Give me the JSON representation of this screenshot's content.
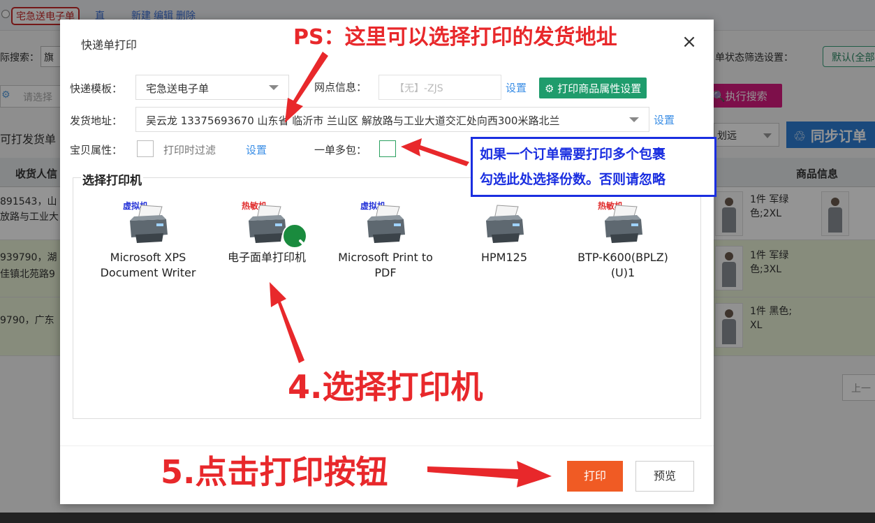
{
  "background": {
    "template_tag": "宅急送电子单",
    "template_tag_more": "直",
    "template_actions": [
      "新建",
      "编辑",
      "删除"
    ],
    "search_label": "际搜索：",
    "search_value": "旗",
    "status_filter_label": "单状态筛选设置：",
    "status_filter_button": "默认(全部",
    "condition_placeholder": "请选择",
    "execute_search_button": "执行搜索",
    "sub_tab": "可打发货单",
    "select_far_value": "划远",
    "sync_button": "同步订单",
    "columns": {
      "receiver": "收货人信",
      "goods": "商品信息"
    },
    "rows": [
      {
        "addr_line1": "891543，山",
        "addr_line2": "放路与工业大",
        "goods1": "1件 军绿\n色;2XL"
      },
      {
        "addr_line1": "939790，湖",
        "addr_line2": "佳镇北苑路9",
        "goods1": "1件 军绿\n色;3XL"
      },
      {
        "addr_line1": "9790，广东",
        "addr_line2": "",
        "goods1": "1件 黑色;\nXL"
      }
    ],
    "pager_prev": "上一"
  },
  "dialog": {
    "title": "快递单打印",
    "close_glyph": "×",
    "template_label": "快递模板：",
    "template_value": "宅急送电子单",
    "outlet_label": "网点信息：",
    "outlet_value": "【无】-ZJS",
    "outlet_settings": "设置",
    "goods_attr_settings_button": "打印商品属性设置",
    "sender_label": "发货地址：",
    "sender_value": "吴云龙 13375693670 山东省 临沂市 兰山区 解放路与工业大道交汇处向西300米路北兰",
    "sender_settings": "设置",
    "item_attr_label": "宝贝属性：",
    "print_filter_label": "打印时过滤",
    "item_attr_settings": "设置",
    "multi_pack_label": "一单多包：",
    "printer_section_title": "选择打印机",
    "printers": [
      {
        "tag": "虚拟机",
        "tag_type": "virtual",
        "name": "Microsoft XPS Document Writer",
        "selected": false
      },
      {
        "tag": "热敏机",
        "tag_type": "thermal",
        "name": "电子面单打印机",
        "selected": true
      },
      {
        "tag": "虚拟机",
        "tag_type": "virtual",
        "name": "Microsoft Print to PDF",
        "selected": false
      },
      {
        "tag": "",
        "tag_type": "none",
        "name": "HPM125",
        "selected": false
      },
      {
        "tag": "热敏机",
        "tag_type": "thermal",
        "name": "BTP-K600(BPLZ) (U)1",
        "selected": false
      }
    ],
    "print_button": "打印",
    "preview_button": "预览"
  },
  "annotations": {
    "ps": "PS：这里可以选择打印的发货地址",
    "note_line1": "如果一个订单需要打印多个包裹",
    "note_line2": "勾选此处选择份数。否则请忽略",
    "step4": "4.选择打印机",
    "step5": "5.点击打印按钮"
  },
  "colors": {
    "print_button": "#f05b24",
    "green_button": "#1f9c6c",
    "annotation_red": "#e8282b",
    "note_blue": "#1a2ee0",
    "link_blue": "#3a8ee6"
  }
}
